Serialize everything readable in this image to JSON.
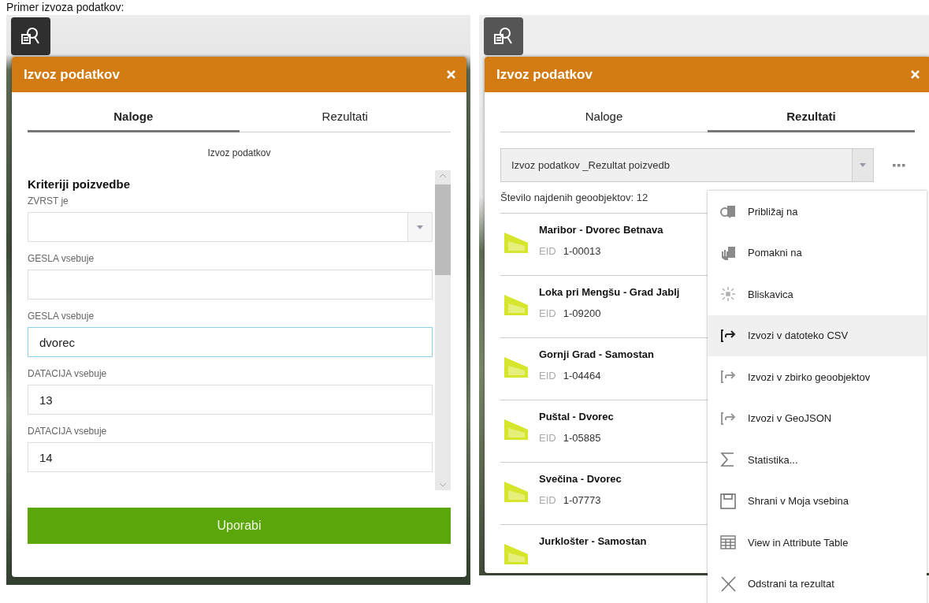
{
  "caption": "Primer izvoza podatkov:",
  "panels": [
    {
      "kind": "tasks",
      "title": "Izvoz podatkov",
      "tabs": [
        {
          "label": "Naloge",
          "selected": true
        },
        {
          "label": "Rezultati",
          "selected": false
        }
      ],
      "task_title": "Izvoz podatkov",
      "section": "Kriteriji poizvedbe",
      "fields": [
        {
          "label": "ZVRST je",
          "kind": "dropdown",
          "focused": false
        },
        {
          "label": "GESLA vsebuje",
          "kind": "text",
          "focused": false
        },
        {
          "label": "GESLA vsebuje",
          "kind": "text",
          "value": "dvorec",
          "focused": true
        },
        {
          "label": "DATACIJA vsebuje",
          "kind": "text",
          "value": "13",
          "focused": false
        },
        {
          "label": "DATACIJA vsebuje",
          "kind": "text",
          "value": "14",
          "focused": false
        }
      ],
      "apply_button": "Uporabi"
    },
    {
      "kind": "results",
      "title": "Izvoz podatkov",
      "tabs": [
        {
          "label": "Naloge",
          "selected": false
        },
        {
          "label": "Rezultati",
          "selected": true
        }
      ],
      "result_set": "Izvoz podatkov _Rezultat poizvedb",
      "count": "Število najdenih geoobjektov: 12",
      "results": [
        {
          "name": "Maribor - Dvorec Betnava",
          "id_label": "EID",
          "id": "1-00013"
        },
        {
          "name": "Loka pri Mengšu - Grad Jablj",
          "id_label": "EID",
          "id": "1-09200"
        },
        {
          "name": "Gornji Grad - Samostan",
          "id_label": "EID",
          "id": "1-04464"
        },
        {
          "name": "Puštal - Dvorec",
          "id_label": "EID",
          "id": "1-05885"
        },
        {
          "name": "Svečina - Dvorec",
          "id_label": "EID",
          "id": "1-07773"
        },
        {
          "name": "Jurklošter - Samostan"
        }
      ],
      "menu": [
        {
          "kind": "zoom",
          "label": "Približaj na",
          "highlighted": false
        },
        {
          "kind": "pan",
          "label": "Pomakni na",
          "highlighted": false
        },
        {
          "kind": "flash",
          "label": "Bliskavica",
          "highlighted": false
        },
        {
          "kind": "export",
          "label": "Izvozi v datoteko CSV",
          "highlighted": true
        },
        {
          "kind": "export",
          "label": "Izvozi v zbirko geoobjektov",
          "highlighted": false
        },
        {
          "kind": "export",
          "label": "Izvozi v GeoJSON",
          "highlighted": false
        },
        {
          "kind": "sum",
          "label": "Statistika...",
          "highlighted": false
        },
        {
          "kind": "save",
          "label": "Shrani v Moja vsebina",
          "highlighted": false
        },
        {
          "kind": "table",
          "label": "View in Attribute Table",
          "highlighted": false
        },
        {
          "kind": "remove",
          "label": "Odstrani ta rezultat",
          "highlighted": false
        }
      ]
    }
  ]
}
